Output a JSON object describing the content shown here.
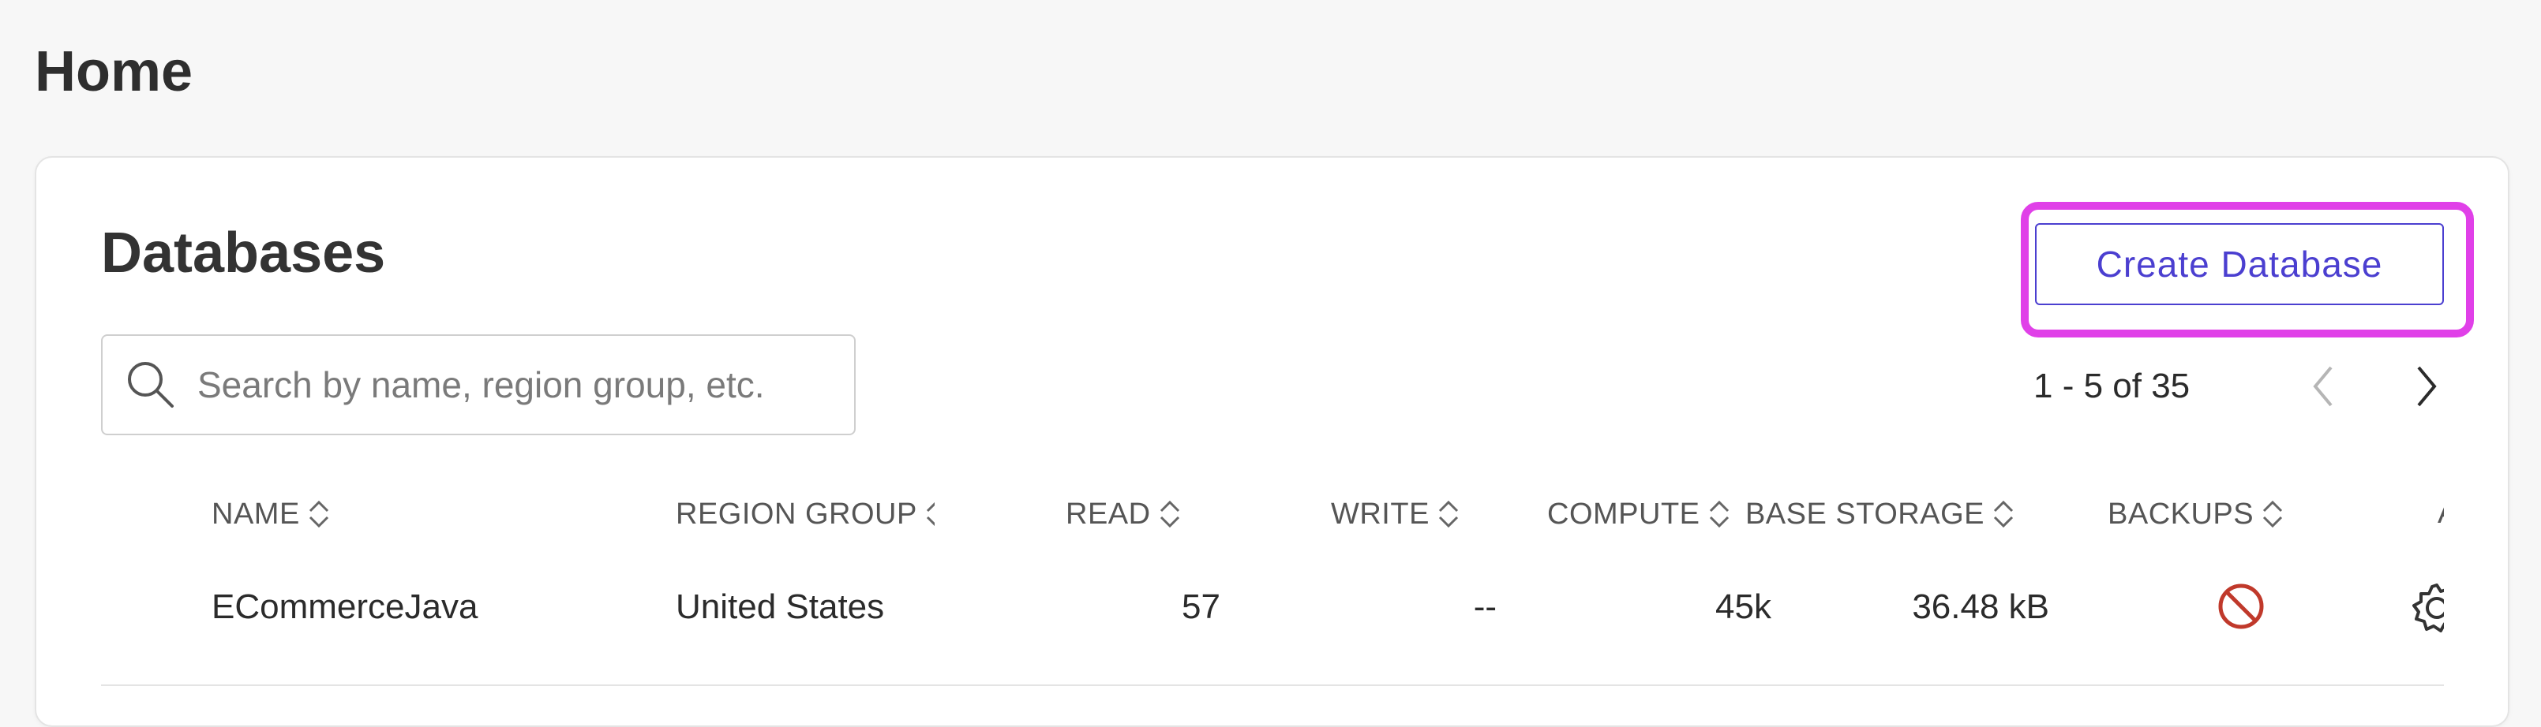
{
  "page": {
    "title": "Home"
  },
  "databases": {
    "title": "Databases",
    "create_button_label": "Create Database",
    "search": {
      "placeholder": "Search by name, region group, etc.",
      "value": ""
    },
    "pagination": {
      "text": "1 - 5 of 35"
    },
    "columns": [
      "NAME",
      "REGION GROUP",
      "READ",
      "WRITE",
      "COMPUTE",
      "DATABASE STORAGE",
      "BACKUPS",
      "ACTIONS"
    ],
    "rows": [
      {
        "name": "ECommerceJava",
        "region_group": "United States",
        "read": "57",
        "write": "--",
        "compute": "45k",
        "storage": "36.48 kB",
        "backups_icon": "no-backups-icon",
        "actions_icon": "gear-icon"
      }
    ]
  },
  "colors": {
    "accent": "#4b3fd0",
    "highlight": "#e040e8",
    "backup_disabled": "#c0392b"
  }
}
